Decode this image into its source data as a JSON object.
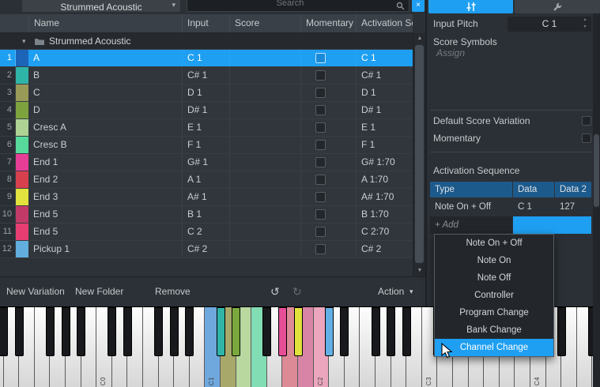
{
  "accent": "#1e9ff2",
  "icons": {
    "chevron_down": "▾",
    "triangle_up": "▲",
    "triangle_down": "▼",
    "undo": "↺",
    "redo": "↻",
    "close": "×",
    "spinner_up": "▴",
    "spinner_down": "▾",
    "expand": "▾"
  },
  "top_bar": {
    "preset_name": "Strummed Acoustic",
    "search_placeholder": "Search"
  },
  "table": {
    "columns": [
      "Name",
      "Input",
      "Score",
      "Momentary",
      "Activation Se"
    ],
    "folder_name": "Strummed Acoustic",
    "rows": [
      {
        "num": "1",
        "color": "#1c64b8",
        "name": "A",
        "input": "C 1",
        "activation": "C 1",
        "selected": true
      },
      {
        "num": "2",
        "color": "#2fb5a8",
        "name": "B",
        "input": "C# 1",
        "activation": "C# 1"
      },
      {
        "num": "3",
        "color": "#9a9a58",
        "name": "C",
        "input": "D 1",
        "activation": "D 1"
      },
      {
        "num": "4",
        "color": "#7ea23e",
        "name": "D",
        "input": "D# 1",
        "activation": "D# 1"
      },
      {
        "num": "5",
        "color": "#aed194",
        "name": "Cresc A",
        "input": "E 1",
        "activation": "E 1"
      },
      {
        "num": "6",
        "color": "#57d99c",
        "name": "Cresc B",
        "input": "F 1",
        "activation": "F 1"
      },
      {
        "num": "7",
        "color": "#e63e96",
        "name": "End 1",
        "input": "G# 1",
        "activation": "G# 1:70"
      },
      {
        "num": "8",
        "color": "#d8404e",
        "name": "End 2",
        "input": "A 1",
        "activation": "A 1:70"
      },
      {
        "num": "9",
        "color": "#e2e23e",
        "name": "End 3",
        "input": "A# 1",
        "activation": "A# 1:70"
      },
      {
        "num": "10",
        "color": "#c23a68",
        "name": "End 5",
        "input": "B 1",
        "activation": "B 1:70"
      },
      {
        "num": "11",
        "color": "#e63e72",
        "name": "End 5",
        "input": "C 2",
        "activation": "C 2:70"
      },
      {
        "num": "12",
        "color": "#62aede",
        "name": "Pickup 1",
        "input": "C# 2",
        "activation": "C# 2"
      }
    ]
  },
  "toolbar": {
    "new_variation": "New Variation",
    "new_folder": "New Folder",
    "remove": "Remove",
    "action": "Action"
  },
  "inspector": {
    "input_pitch_label": "Input Pitch",
    "input_pitch_value": "C 1",
    "score_symbols_label": "Score Symbols",
    "assign_placeholder": "Assign",
    "default_score_variation_label": "Default Score Variation",
    "momentary_label": "Momentary",
    "activation_sequence_label": "Activation Sequence",
    "seq_columns": [
      "Type",
      "Data",
      "Data 2"
    ],
    "seq_rows": [
      {
        "type": "Note On + Off",
        "data": "C 1",
        "data2": "127"
      }
    ],
    "add_label": "+ Add",
    "type_menu": {
      "items": [
        "Note On + Off",
        "Note On",
        "Note Off",
        "Controller",
        "Program Change",
        "Bank Change",
        "Channel Change"
      ],
      "highlighted": "Channel Change"
    }
  },
  "keyboard": {
    "octave_labels": [
      "C0",
      "C1",
      "C2",
      "C3",
      "C4"
    ],
    "key_colors": {
      "C1": "#6fa8dc",
      "C#1": "#2fb5a8",
      "D1": "#a8a86a",
      "D#1": "#7aa83e",
      "E1": "#b8d8a0",
      "F1": "#82dcb4",
      "G#1": "#e64e96",
      "A1": "#dc8a96",
      "A#1": "#e2e23e",
      "B1": "#d884a6",
      "C2": "#eba6bd",
      "C#2": "#62b0e6"
    }
  }
}
